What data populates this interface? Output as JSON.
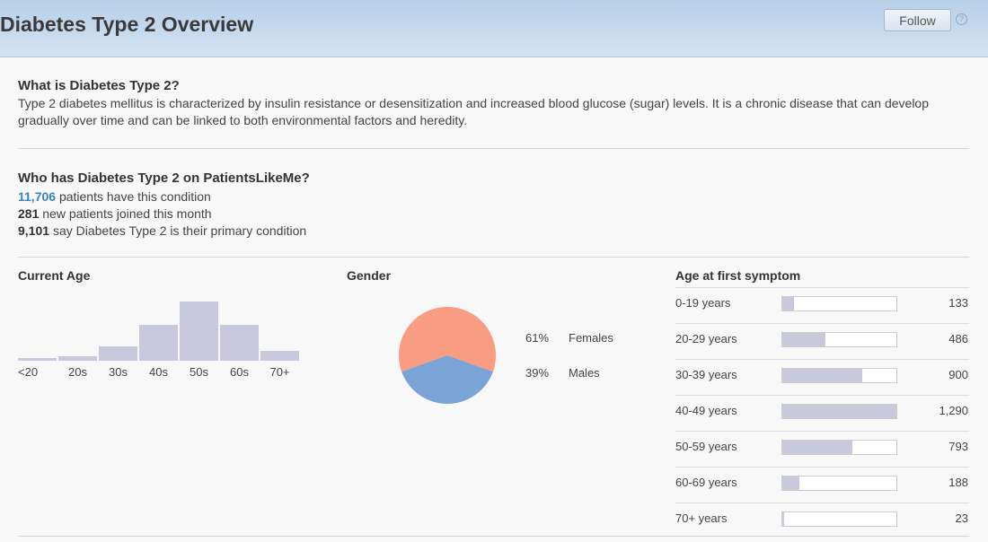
{
  "header": {
    "title": "Diabetes Type 2 Overview",
    "follow_label": "Follow",
    "help_label": "?"
  },
  "about": {
    "heading": "What is Diabetes Type 2?",
    "line1": "Type 2 diabetes mellitus is characterized by insulin resistance or desensitization and increased blood glucose (sugar) levels. It is a chronic disease that can develop",
    "line2": "gradually over time and can be linked to both environmental factors and heredity."
  },
  "who": {
    "heading": "Who has Diabetes Type 2 on PatientsLikeMe?",
    "patients_count": "11,706",
    "patients_text": "patients have this condition",
    "new_count": "281",
    "new_text": "new patients joined this month",
    "primary_count": "9,101",
    "primary_text": "say Diabetes Type 2 is their primary condition"
  },
  "current_age": {
    "title": "Current Age",
    "chart_data": {
      "type": "bar",
      "categories": [
        "<20",
        "20s",
        "30s",
        "40s",
        "50s",
        "60s",
        "70+"
      ],
      "values": [
        3,
        6,
        18,
        45,
        75,
        46,
        12
      ]
    }
  },
  "gender": {
    "title": "Gender",
    "chart_data": {
      "type": "pie",
      "slices": [
        {
          "label": "Females",
          "percent": "61%",
          "value": 61,
          "color": "#f89c82"
        },
        {
          "label": "Males",
          "percent": "39%",
          "value": 39,
          "color": "#7aa3d6"
        }
      ]
    }
  },
  "age_first_symptom": {
    "title": "Age at first symptom",
    "chart_data": {
      "type": "bar",
      "rows": [
        {
          "label": "0-19 years",
          "display": "133",
          "value": 133
        },
        {
          "label": "20-29 years",
          "display": "486",
          "value": 486
        },
        {
          "label": "30-39 years",
          "display": "900",
          "value": 900
        },
        {
          "label": "40-49 years",
          "display": "1,290",
          "value": 1290
        },
        {
          "label": "50-59 years",
          "display": "793",
          "value": 793
        },
        {
          "label": "60-69 years",
          "display": "188",
          "value": 188
        },
        {
          "label": "70+ years",
          "display": "23",
          "value": 23
        }
      ],
      "max": 1290
    }
  },
  "colors": {
    "bar": "#c9c9de",
    "link": "#3a83c2"
  }
}
